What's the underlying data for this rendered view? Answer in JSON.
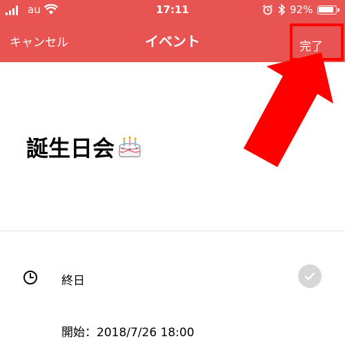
{
  "status_bar": {
    "carrier": "au",
    "time": "17:11",
    "battery_percent": "92%",
    "battery_level": 0.92
  },
  "nav": {
    "cancel_label": "キャンセル",
    "title": "イベント",
    "done_label": "完了"
  },
  "event": {
    "title": "誕生日会",
    "title_emoji": "cake-icon",
    "all_day_label": "終日",
    "all_day_enabled": false,
    "start_text": "開始：2018/7/26 18:00"
  },
  "annotation": {
    "highlight_color": "#ff0000",
    "target": "done-button"
  },
  "colors": {
    "header": "#e85452",
    "accent": "#ff0000",
    "toggle_off": "#d6d6d9"
  }
}
